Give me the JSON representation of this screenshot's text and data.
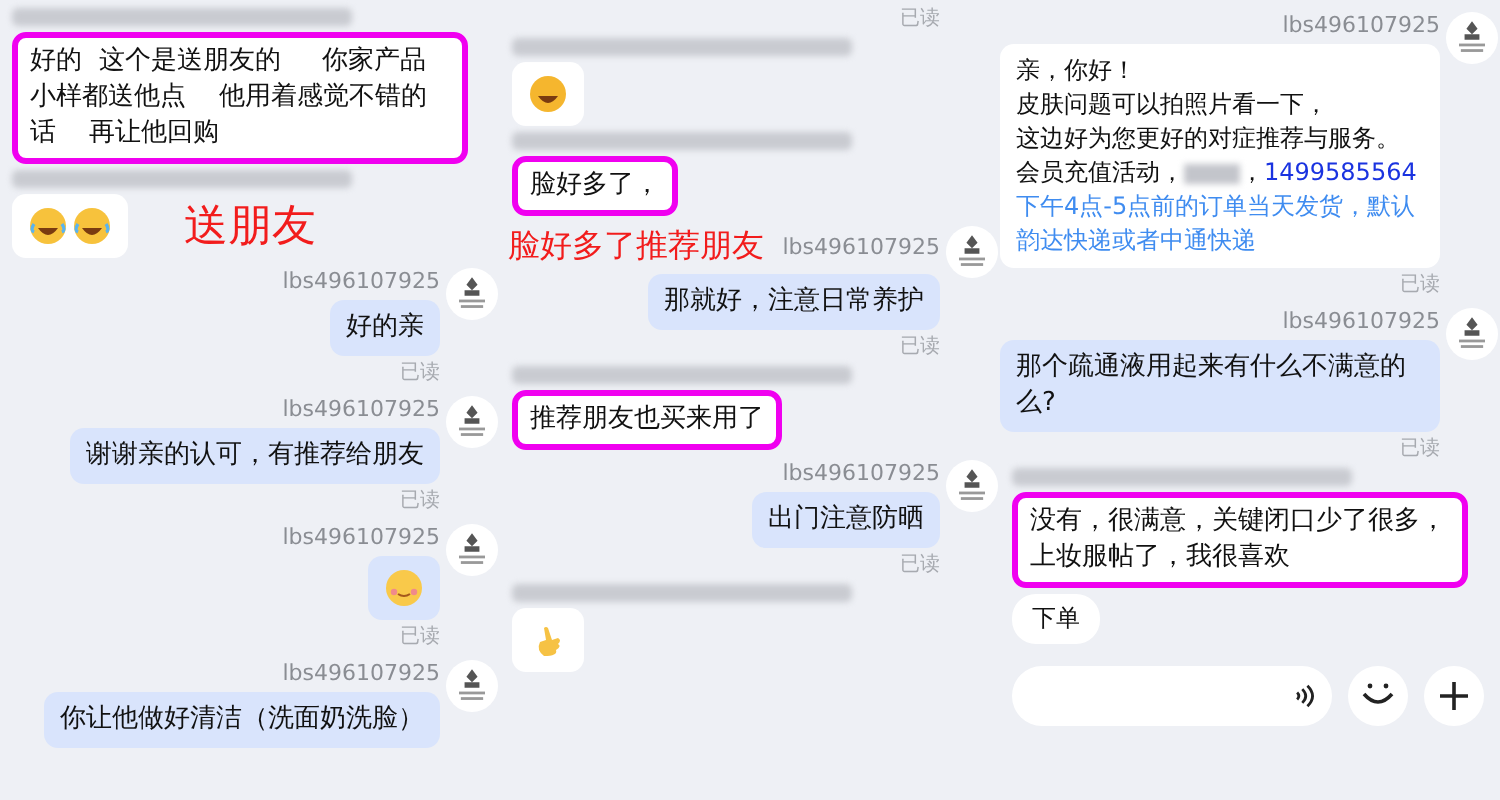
{
  "panels": [
    {
      "items": [
        {
          "kind": "sender_blur"
        },
        {
          "kind": "incoming_text",
          "highlighted": true,
          "paragraphs": [
            [
              {
                "kind": "plain",
                "text": "好的  这个是送朋友的     你家产品小样都送他点    他用着感觉不错的话    再让他回购"
              }
            ]
          ]
        },
        {
          "kind": "sender_blur"
        },
        {
          "kind": "incoming_emoji",
          "emojis": [
            {
              "kind": "laughing"
            },
            {
              "kind": "laughing"
            }
          ],
          "annotation": "送朋友"
        },
        {
          "kind": "sender",
          "name": "lbs496107925"
        },
        {
          "kind": "outgoing_text",
          "highlighted": false,
          "paragraphs": [
            [
              {
                "kind": "plain",
                "text": "好的亲"
              }
            ]
          ]
        },
        {
          "kind": "read",
          "text": "已读"
        },
        {
          "kind": "sender",
          "name": "lbs496107925"
        },
        {
          "kind": "outgoing_text",
          "highlighted": false,
          "paragraphs": [
            [
              {
                "kind": "plain",
                "text": "谢谢亲的认可，有推荐给朋友"
              }
            ]
          ]
        },
        {
          "kind": "read",
          "text": "已读"
        },
        {
          "kind": "sender",
          "name": "lbs496107925"
        },
        {
          "kind": "outgoing_emoji",
          "emojis": [
            {
              "kind": "blushing"
            }
          ]
        },
        {
          "kind": "read",
          "text": "已读"
        },
        {
          "kind": "sender",
          "name": "lbs496107925"
        },
        {
          "kind": "outgoing_text",
          "highlighted": false,
          "paragraphs": [
            [
              {
                "kind": "plain",
                "text": "你让他做好清洁（洗面奶洗脸）"
              }
            ]
          ]
        }
      ]
    },
    {
      "items": [
        {
          "kind": "read",
          "text": "已读"
        },
        {
          "kind": "sender_blur"
        },
        {
          "kind": "incoming_emoji",
          "emojis": [
            {
              "kind": "grinning"
            }
          ]
        },
        {
          "kind": "sender_blur"
        },
        {
          "kind": "incoming_text",
          "highlighted": true,
          "paragraphs": [
            [
              {
                "kind": "plain",
                "text": "脸好多了，"
              }
            ]
          ]
        },
        {
          "kind": "sender",
          "name": "lbs496107925",
          "annotation": "脸好多了推荐朋友"
        },
        {
          "kind": "outgoing_text",
          "highlighted": false,
          "paragraphs": [
            [
              {
                "kind": "plain",
                "text": "那就好，注意日常养护"
              }
            ]
          ]
        },
        {
          "kind": "read",
          "text": "已读"
        },
        {
          "kind": "sender_blur"
        },
        {
          "kind": "incoming_text",
          "highlighted": true,
          "paragraphs": [
            [
              {
                "kind": "plain",
                "text": "推荐朋友也买来用了"
              }
            ]
          ]
        },
        {
          "kind": "sender",
          "name": "lbs496107925"
        },
        {
          "kind": "outgoing_text",
          "highlighted": false,
          "paragraphs": [
            [
              {
                "kind": "plain",
                "text": "出门注意防晒"
              }
            ]
          ]
        },
        {
          "kind": "read",
          "text": "已读"
        },
        {
          "kind": "sender_blur"
        },
        {
          "kind": "incoming_emoji",
          "emojis": [
            {
              "kind": "hand"
            }
          ]
        }
      ]
    },
    {
      "items": [
        {
          "kind": "sender",
          "name": "lbs496107925"
        },
        {
          "kind": "outgoing_card",
          "highlighted": false,
          "paragraphs": [
            [
              {
                "kind": "plain",
                "text": "亲，你好！"
              }
            ],
            [
              {
                "kind": "plain",
                "text": "皮肤问题可以拍照片看一下，"
              }
            ],
            [
              {
                "kind": "plain",
                "text": "这边好为您更好的对症推荐与服务。"
              }
            ],
            [
              {
                "kind": "plain",
                "text": "会员充值活动，"
              },
              {
                "kind": "blurred"
              },
              {
                "kind": "plain",
                "text": "，"
              },
              {
                "kind": "phone",
                "text": "1499585564"
              }
            ],
            [
              {
                "kind": "link",
                "text": "下午4点-5点前的订单当天发货，默认韵达快递或者中通快递"
              }
            ]
          ]
        },
        {
          "kind": "read",
          "text": "已读"
        },
        {
          "kind": "sender",
          "name": "lbs496107925"
        },
        {
          "kind": "outgoing_text",
          "highlighted": false,
          "paragraphs": [
            [
              {
                "kind": "plain",
                "text": "那个疏通液用起来有什么不满意的么?"
              }
            ]
          ]
        },
        {
          "kind": "read",
          "text": "已读"
        },
        {
          "kind": "sender_blur"
        },
        {
          "kind": "incoming_text",
          "highlighted": true,
          "paragraphs": [
            [
              {
                "kind": "plain",
                "text": "没有，很满意，关键闭口少了很多，上妆服帖了，我很喜欢"
              }
            ]
          ]
        },
        {
          "kind": "chip",
          "text": "下单"
        },
        {
          "kind": "input"
        }
      ]
    }
  ]
}
